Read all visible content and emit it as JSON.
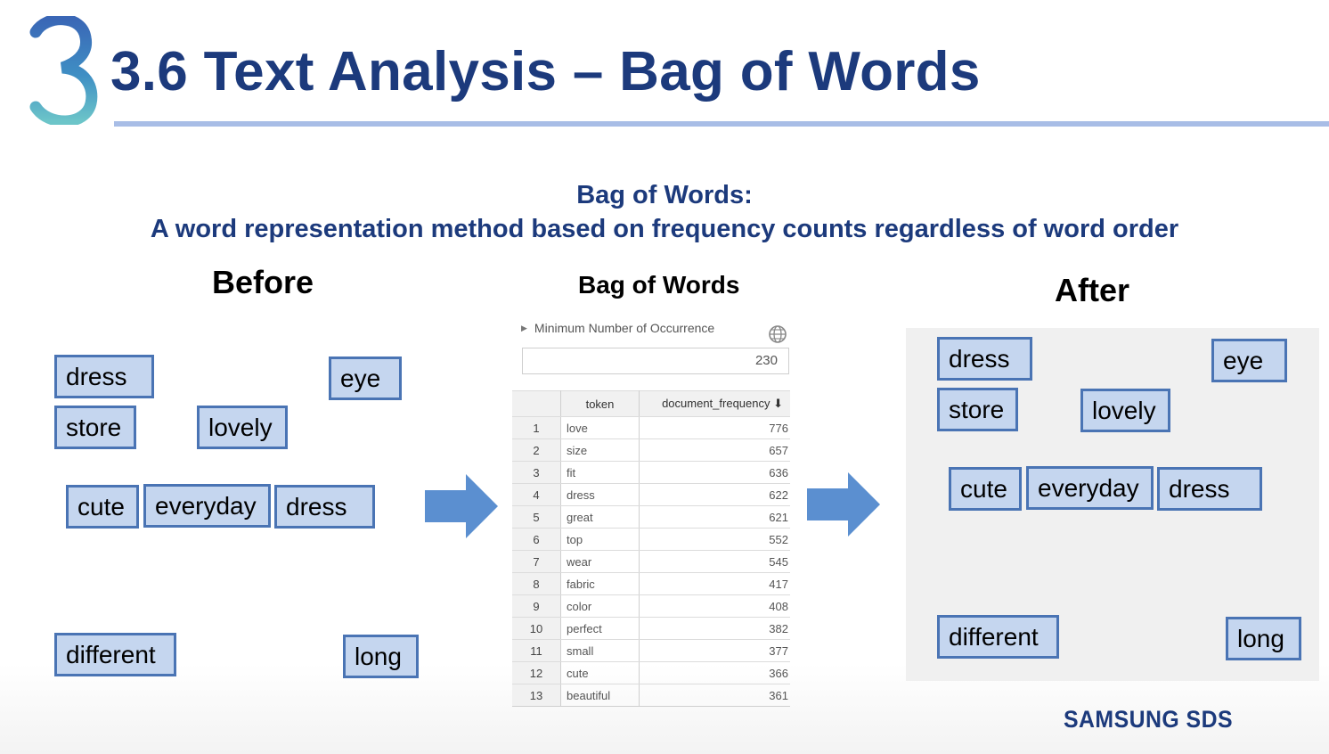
{
  "slide": {
    "title": "3.6 Text Analysis – Bag of Words",
    "subtitle_line1": "Bag of Words:",
    "subtitle_line2": "A word representation method based on frequency counts regardless of word order",
    "brand": "SAMSUNG SDS",
    "colors": {
      "title": "#1c3a7c",
      "rule": "#a8bde6",
      "word_fill": "#c5d6ef",
      "word_border": "#4a74b4",
      "arrow": "#5b8fd0",
      "after_panel": "#f0f0f0"
    },
    "logo_icon": "b-logo-icon",
    "arrow_icon": "right-arrow-icon",
    "settings_icon": "globe-icon"
  },
  "before": {
    "heading": "Before",
    "words": [
      "dress",
      "eye",
      "store",
      "lovely",
      "cute",
      "everyday",
      "dress",
      "different",
      "long"
    ]
  },
  "bag": {
    "heading": "Bag of Words",
    "min_label": "Minimum Number of Occurrence",
    "min_value": "230",
    "columns": [
      "",
      "token",
      "document_frequency ⬇"
    ],
    "rows": [
      {
        "idx": "1",
        "token": "love",
        "freq": "776"
      },
      {
        "idx": "2",
        "token": "size",
        "freq": "657"
      },
      {
        "idx": "3",
        "token": "fit",
        "freq": "636"
      },
      {
        "idx": "4",
        "token": "dress",
        "freq": "622"
      },
      {
        "idx": "5",
        "token": "great",
        "freq": "621"
      },
      {
        "idx": "6",
        "token": "top",
        "freq": "552"
      },
      {
        "idx": "7",
        "token": "wear",
        "freq": "545"
      },
      {
        "idx": "8",
        "token": "fabric",
        "freq": "417"
      },
      {
        "idx": "9",
        "token": "color",
        "freq": "408"
      },
      {
        "idx": "10",
        "token": "perfect",
        "freq": "382"
      },
      {
        "idx": "11",
        "token": "small",
        "freq": "377"
      },
      {
        "idx": "12",
        "token": "cute",
        "freq": "366"
      },
      {
        "idx": "13",
        "token": "beautiful",
        "freq": "361"
      }
    ]
  },
  "after": {
    "heading": "After",
    "words": [
      "dress",
      "eye",
      "store",
      "lovely",
      "cute",
      "everyday",
      "dress",
      "different",
      "long"
    ]
  }
}
